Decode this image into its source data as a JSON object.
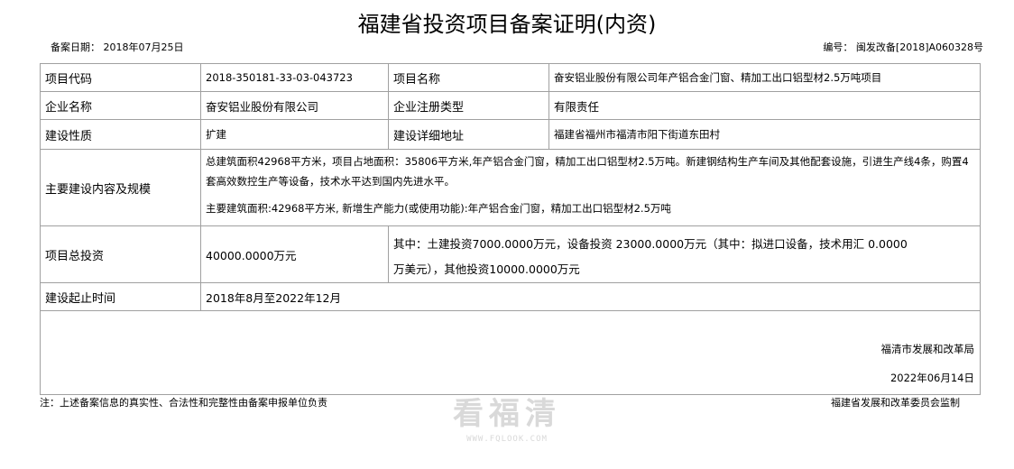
{
  "doc": {
    "title": "福建省投资项目备案证明(内资)",
    "filing_date": "备案日期：   2018年07月25日",
    "number": "编号：   闽发改备[2018]A060328号"
  },
  "rows": {
    "project_code_label": "项目代码",
    "project_code": "2018-350181-33-03-043723",
    "project_name_label": "项目名称",
    "project_name": "奋安铝业股份有限公司年产铝合金门窗、精加工出口铝型材2.5万吨项目",
    "company_label": "企业名称",
    "company": "奋安铝业股份有限公司",
    "reg_type_label": "企业注册类型",
    "reg_type": "有限责任",
    "nature_label": "建设性质",
    "nature": "扩建",
    "address_label": "建设详细地址",
    "address": "福建省福州市福清市阳下街道东田村",
    "content_label": "主要建设内容及规模",
    "content_p1": "总建筑面积42968平方米，项目占地面积：35806平方米,年产铝合金门窗，精加工出口铝型材2.5万吨。新建钢结构生产车间及其他配套设施，引进生产线4条，购置4套高效数控生产等设备，技术水平达到国内先进水平。",
    "content_p2": "主要建筑面积:42968平方米, 新增生产能力(或使用功能):年产铝合金门窗，精加工出口铝型材2.5万吨",
    "invest_label": "项目总投资",
    "invest_total": "40000.0000万元",
    "invest_detail_1": "其中：土建投资7000.0000万元，设备投资 23000.0000万元（其中：拟进口设备，技术用汇 0.0000",
    "invest_detail_2": "万美元），其他投资10000.0000万元",
    "period_label": "建设起止时间",
    "period": "2018年8月至2022年12月"
  },
  "signature": {
    "department": "福清市发展和改革局",
    "date": "2022年06月14日"
  },
  "footer": {
    "note": "注：上述备案信息的真实性、合法性和完整性由备案申报单位负责",
    "supervisor": "福建省发展和改革委员会监制"
  },
  "watermark": {
    "text": "看福清",
    "url": "WWW.FQLOOK.COM"
  }
}
